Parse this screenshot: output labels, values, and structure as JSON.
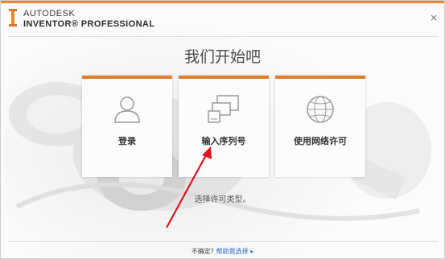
{
  "header": {
    "brand_line1": "AUTODESK",
    "brand_line2": "INVENTOR® PROFESSIONAL",
    "close_label": "×"
  },
  "title": "我们开始吧",
  "cards": [
    {
      "label": "登录",
      "icon": "user-icon"
    },
    {
      "label": "输入序列号",
      "icon": "devices-icon"
    },
    {
      "label": "使用网络许可",
      "icon": "globe-icon"
    }
  ],
  "status_text": "选择许可类型。",
  "footer": {
    "prompt": "不确定?",
    "link_label": "帮助我选择 ▸"
  },
  "colors": {
    "accent": "#e8872c",
    "card_top": "#e27f2c",
    "link": "#2a6fc9"
  }
}
